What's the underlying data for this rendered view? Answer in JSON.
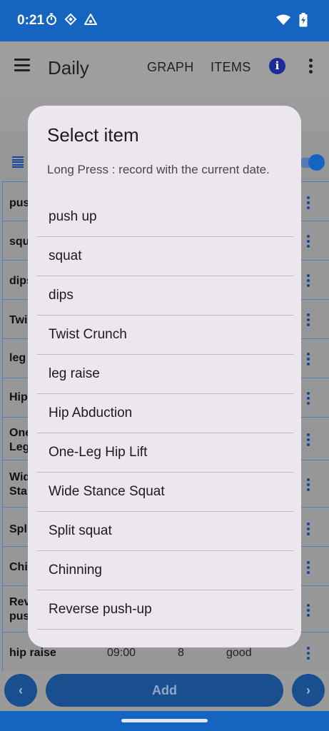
{
  "status": {
    "time": "0:21"
  },
  "appbar": {
    "title": "Daily",
    "actions": [
      "GRAPH",
      "ITEMS"
    ],
    "info_icon": "info-icon",
    "overflow_icon": "more-vert-icon"
  },
  "background_rows": [
    {
      "name": "push up"
    },
    {
      "name": "squat"
    },
    {
      "name": "dips"
    },
    {
      "name": "Twist Crunch"
    },
    {
      "name": "leg raise"
    },
    {
      "name": "Hip Abduction"
    },
    {
      "name": "One-Leg Hip Lift"
    },
    {
      "name": "Wide Stance Squat"
    },
    {
      "name": "Split squat"
    },
    {
      "name": "Chinning"
    },
    {
      "name": "Reverse push-up"
    },
    {
      "name": "hip raise",
      "time": "09:00",
      "count": "8",
      "rating": "good"
    }
  ],
  "bottom": {
    "prev": "‹",
    "add": "Add",
    "next": "›"
  },
  "dialog": {
    "title": "Select item",
    "message": "Long Press : record with the current date.",
    "items": [
      "push up",
      "squat",
      "dips",
      "Twist Crunch",
      "leg raise",
      "Hip Abduction",
      "One-Leg Hip Lift",
      "Wide Stance Squat",
      "Split squat",
      "Chinning",
      "Reverse push-up"
    ]
  },
  "colors": {
    "primary": "#1565c0",
    "dialog_bg": "#ece6ef",
    "scrim": "#969696"
  }
}
